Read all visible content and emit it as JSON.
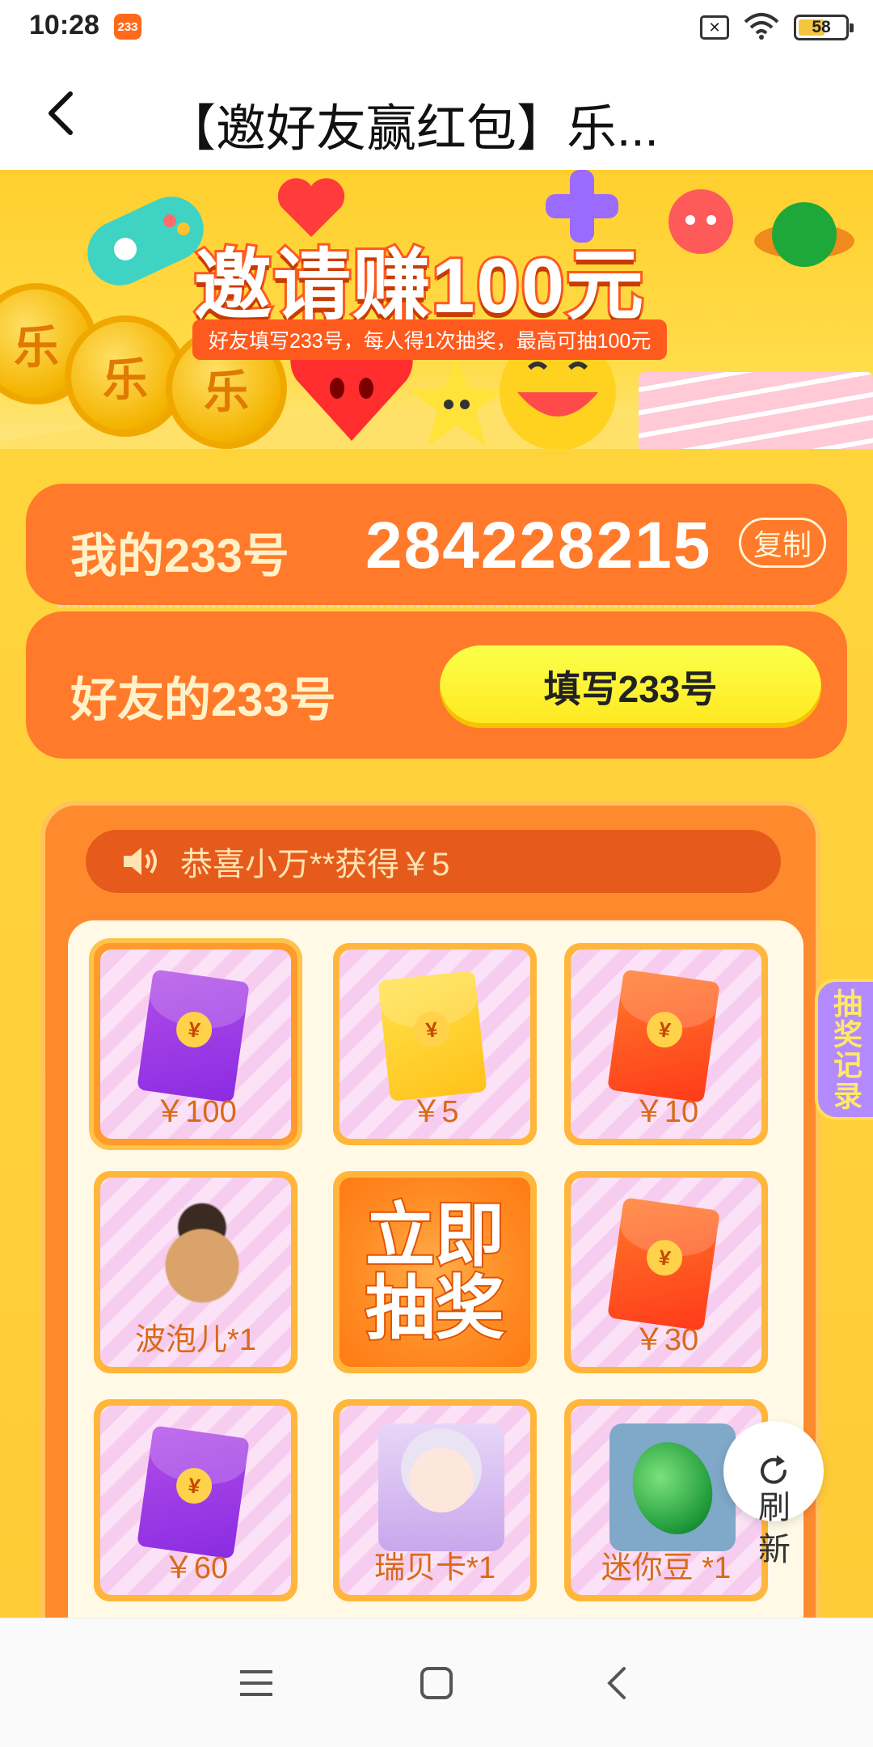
{
  "status_bar": {
    "time": "10:28",
    "app_badge": "233",
    "battery": "58",
    "icons": [
      "sim-off-icon",
      "wifi-icon",
      "battery-icon"
    ]
  },
  "header": {
    "title": "【邀好友赢红包】乐..."
  },
  "banner": {
    "title": "邀请赚100元",
    "subtitle": "好友填写233号，每人得1次抽奖，最高可抽100元",
    "coin_char": "乐"
  },
  "id_panel": {
    "my_label": "我的233号",
    "my_number": "284228215",
    "copy_label": "复制",
    "friend_label": "好友的233号",
    "fill_button": "填写233号"
  },
  "lottery": {
    "ticker": "恭喜小万**获得￥5",
    "draw_button": "立即抽奖",
    "prizes": [
      {
        "label": "￥100",
        "icon": "purple-red-envelope-icon"
      },
      {
        "label": "￥5",
        "icon": "gold-red-envelope-icon"
      },
      {
        "label": "￥10",
        "icon": "orange-red-envelope-icon"
      },
      {
        "label": "波泡儿*1",
        "icon": "pirate-pet-icon"
      },
      {
        "label": "￥30",
        "icon": "orange-red-envelope-icon"
      },
      {
        "label": "￥60",
        "icon": "purple-red-envelope-icon"
      },
      {
        "label": "瑞贝卡*1",
        "icon": "anime-girl-icon"
      },
      {
        "label": "迷你豆 *1",
        "icon": "green-bean-icon"
      }
    ]
  },
  "side_tab": {
    "label": "抽奖记录"
  },
  "refresh": {
    "label": "刷新"
  },
  "colors": {
    "accent_orange": "#ff7a2a",
    "banner_yellow": "#ffd63a",
    "button_yellow": "#fbff4a",
    "side_tab_purple": "#b38bff"
  }
}
